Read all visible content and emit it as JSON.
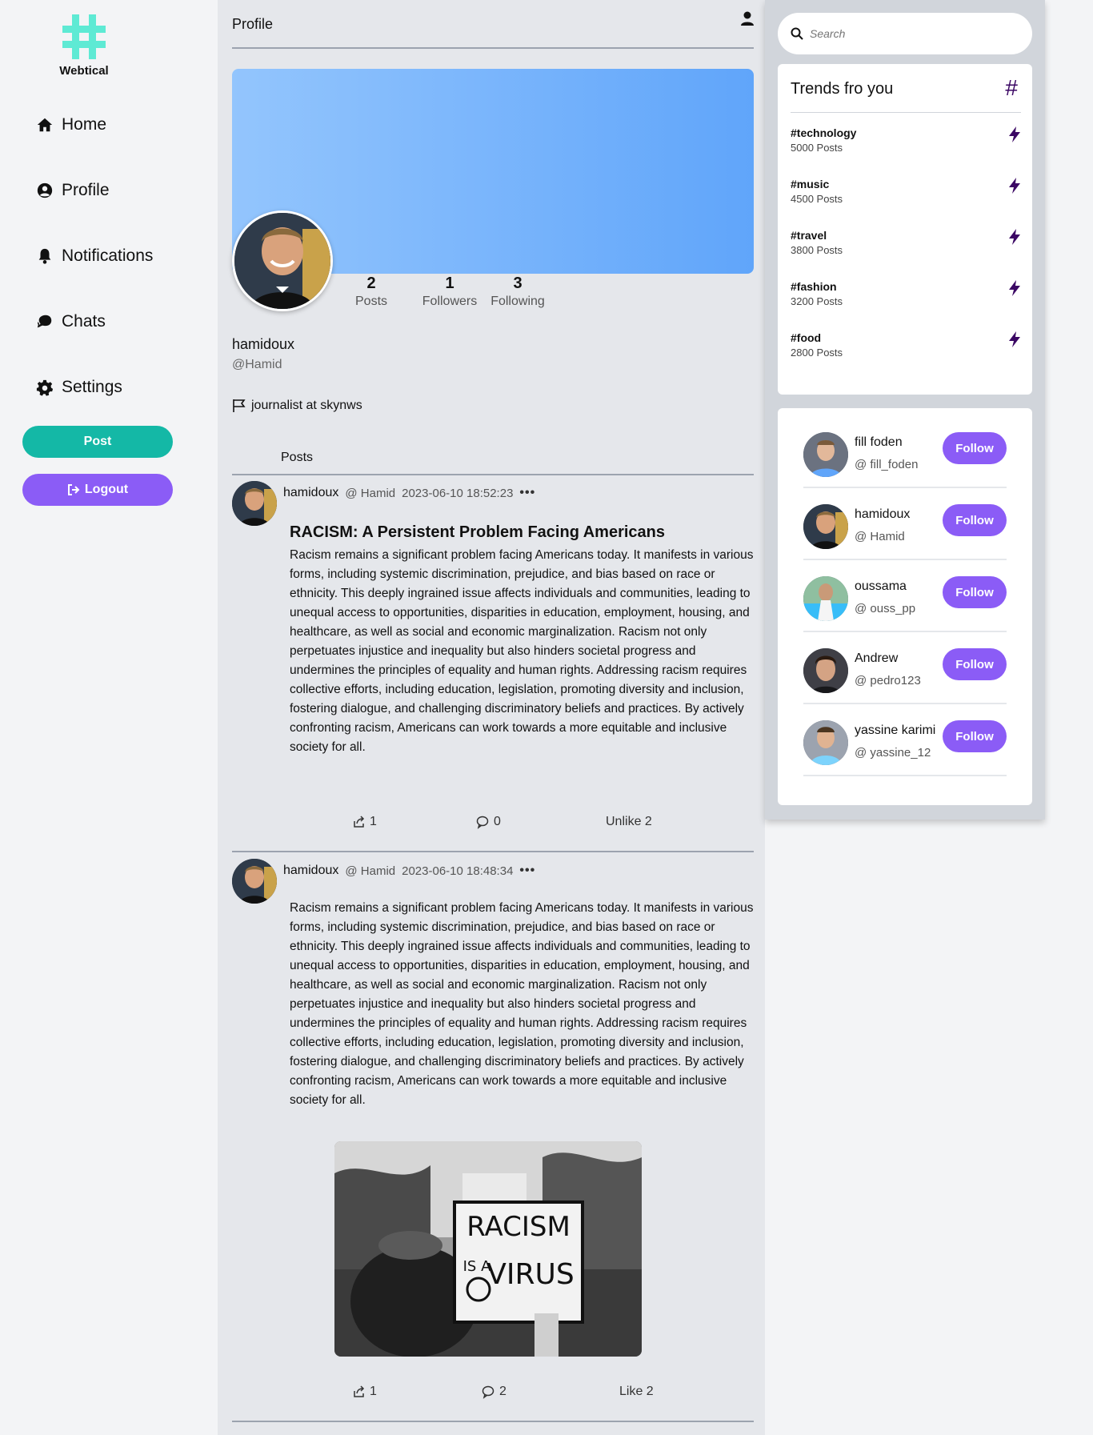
{
  "app": {
    "name": "Webtical"
  },
  "sidebar": {
    "items": [
      {
        "label": "Home",
        "icon": "home-icon"
      },
      {
        "label": "Profile",
        "icon": "user-circle-icon"
      },
      {
        "label": "Notifications",
        "icon": "bell-icon"
      },
      {
        "label": "Chats",
        "icon": "chat-icon"
      },
      {
        "label": "Settings",
        "icon": "gear-icon"
      }
    ],
    "post_label": "Post",
    "logout_label": "Logout"
  },
  "header": {
    "title": "Profile"
  },
  "profile": {
    "name": "hamidoux",
    "handle": "@Hamid",
    "bio": "journalist at skynws",
    "stats": [
      {
        "value": "2",
        "label": "Posts"
      },
      {
        "value": "1",
        "label": "Followers"
      },
      {
        "value": "3",
        "label": "Following"
      }
    ],
    "posts_tab": "Posts"
  },
  "posts": [
    {
      "user": "hamidoux",
      "handle": "@ Hamid",
      "date": "2023-06-10 18:52:23",
      "title": "RACISM: A Persistent Problem Facing Americans",
      "body": "Racism remains a significant problem facing Americans today. It manifests in various forms, including systemic discrimination, prejudice, and bias based on race or ethnicity. This deeply ingrained issue affects individuals and communities, leading to unequal access to opportunities, disparities in education, employment, housing, and healthcare, as well as social and economic marginalization. Racism not only perpetuates injustice and inequality but also hinders societal progress and undermines the principles of equality and human rights. Addressing racism requires collective efforts, including education, legislation, promoting diversity and inclusion, fostering dialogue, and challenging discriminatory beliefs and practices. By actively confronting racism, Americans can work towards a more equitable and inclusive society for all.",
      "shares": "1",
      "comments": "0",
      "like_label": "Unlike 2"
    },
    {
      "user": "hamidoux",
      "handle": "@ Hamid",
      "date": "2023-06-10 18:48:34",
      "title": "",
      "body": "Racism remains a significant problem facing Americans today. It manifests in various forms, including systemic discrimination, prejudice, and bias based on race or ethnicity. This deeply ingrained issue affects individuals and communities, leading to unequal access to opportunities, disparities in education, employment, housing, and healthcare, as well as social and economic marginalization. Racism not only perpetuates injustice and inequality but also hinders societal progress and undermines the principles of equality and human rights. Addressing racism requires collective efforts, including education, legislation, promoting diversity and inclusion, fostering dialogue, and challenging discriminatory beliefs and practices. By actively confronting racism, Americans can work towards a more equitable and inclusive society for all.",
      "image_sign_line1": "RACISM",
      "image_sign_line2": "IS A",
      "image_sign_line3": "VIRUS",
      "shares": "1",
      "comments": "2",
      "like_label": "Like 2"
    }
  ],
  "search": {
    "placeholder": "Search"
  },
  "trends": {
    "title": "Trends fro you",
    "items": [
      {
        "tag": "#technology",
        "count": "5000 Posts"
      },
      {
        "tag": "#music",
        "count": "4500 Posts"
      },
      {
        "tag": "#travel",
        "count": "3800 Posts"
      },
      {
        "tag": "#fashion",
        "count": "3200 Posts"
      },
      {
        "tag": "#food",
        "count": "2800 Posts"
      }
    ]
  },
  "suggestions": {
    "follow_label": "Follow",
    "users": [
      {
        "name": "fill foden",
        "handle": "@ fill_foden"
      },
      {
        "name": "hamidoux",
        "handle": "@ Hamid"
      },
      {
        "name": "oussama",
        "handle": "@ ouss_pp"
      },
      {
        "name": "Andrew",
        "handle": "@ pedro123"
      },
      {
        "name": "yassine karimi",
        "handle": "@ yassine_12"
      }
    ]
  },
  "colors": {
    "accent_teal": "#14b8a6",
    "accent_purple": "#8b5cf6",
    "logo": "#5eead4"
  }
}
